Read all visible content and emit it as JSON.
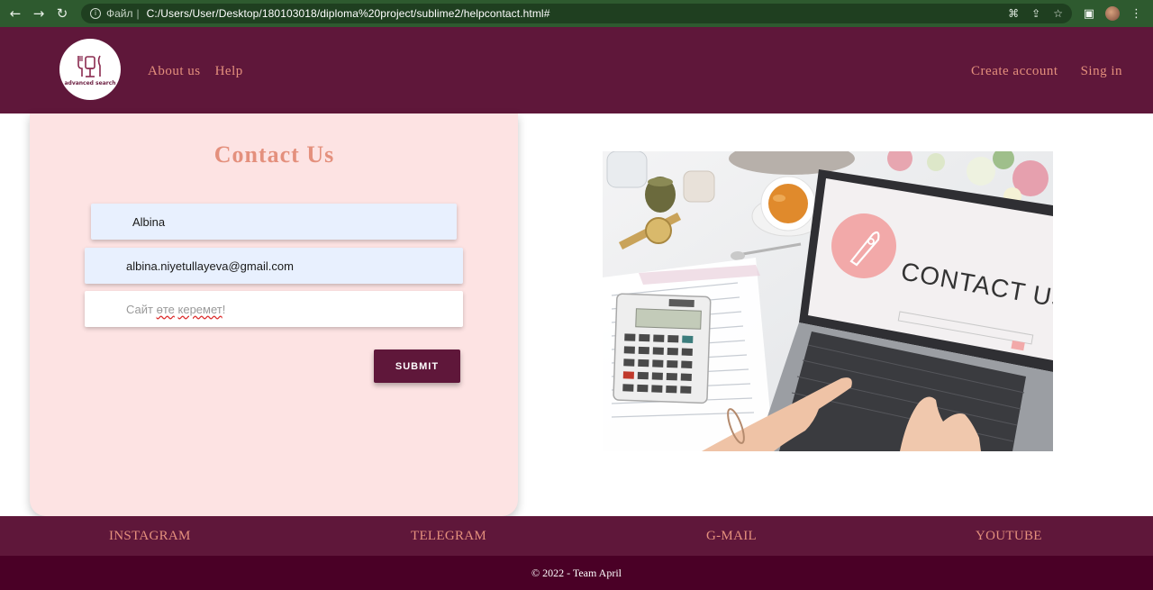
{
  "browser": {
    "scheme_label": "Файл",
    "separator": "|",
    "url": "C:/Users/User/Desktop/180103018/diploma%20project/sublime2/helpcontact.html#",
    "nav_icons": [
      "back-icon",
      "forward-icon",
      "reload-icon"
    ],
    "omnibox_icons": [
      "translate-icon",
      "share-icon",
      "bookmark-star-icon"
    ],
    "toolbar_icons": [
      "side-panel-icon",
      "profile-avatar",
      "menu-icon"
    ]
  },
  "header": {
    "logo_text": "advanced search",
    "nav_left": [
      "About us",
      "Help"
    ],
    "nav_right": [
      "Create account",
      "Sing in"
    ]
  },
  "contact": {
    "title": "Contact Us",
    "name_value": "Albina",
    "email_value": "albina.niyetullayeva@gmail.com",
    "message_prefix": "Сайт ",
    "message_word1": "өте",
    "message_space": " ",
    "message_word2": "керемет",
    "message_suffix": "!",
    "submit_label": "SUBMIT"
  },
  "photo": {
    "screen_text": "CONTACT US"
  },
  "footer": {
    "social": [
      "INSTAGRAM",
      "TELEGRAM",
      "G-MAIL",
      "YOUTUBE"
    ],
    "copyright": "© 2022 - Team April"
  },
  "colors": {
    "header_bg": "#5f173a",
    "accent_text": "#e4907d",
    "card_bg": "#fde3e3",
    "autofill_bg": "#e8f0fe",
    "footer_dark": "#4a0026",
    "chrome_green": "#2e5a2f"
  }
}
